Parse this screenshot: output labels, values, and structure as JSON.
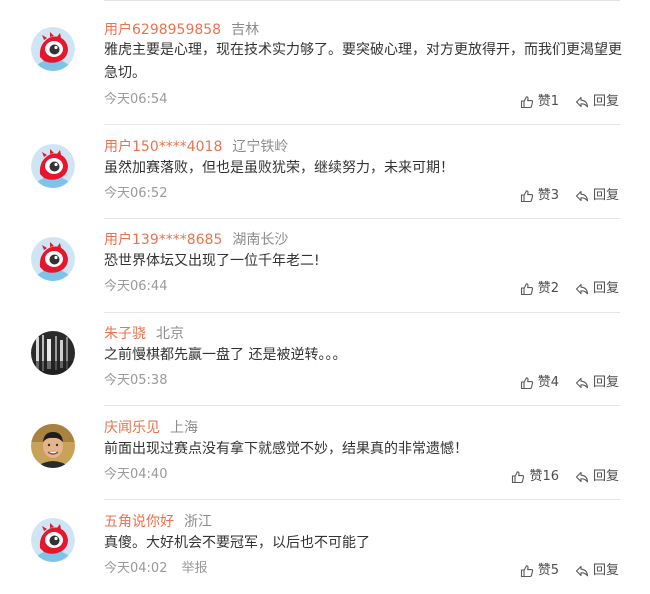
{
  "comments": [
    {
      "user": "用户6298959858",
      "location": "吉林",
      "text": "雅虎主要是心理，现在技术实力够了。要突破心理，对方更放得开，而我们更渴望更急切。",
      "time": "今天06:54",
      "like_label": "赞1",
      "reply_label": "回复",
      "report_label": "",
      "avatar": "weibo-default-avatar"
    },
    {
      "user": "用户150****4018",
      "location": "辽宁铁岭",
      "text": "虽然加赛落败，但也是虽败犹荣，继续努力，未来可期！",
      "time": "今天06:52",
      "like_label": "赞3",
      "reply_label": "回复",
      "report_label": "",
      "avatar": "weibo-default-avatar"
    },
    {
      "user": "用户139****8685",
      "location": "湖南长沙",
      "text": "恐世界体坛又出现了一位千年老二!",
      "time": "今天06:44",
      "like_label": "赞2",
      "reply_label": "回复",
      "report_label": "",
      "avatar": "weibo-default-avatar"
    },
    {
      "user": "朱子骁",
      "location": "北京",
      "text": "之前慢棋都先赢一盘了 还是被逆转。。。",
      "time": "今天05:38",
      "like_label": "赞4",
      "reply_label": "回复",
      "report_label": "",
      "avatar": "photo-avatar-dark"
    },
    {
      "user": "庆闻乐见",
      "location": "上海",
      "text": "前面出现过赛点没有拿下就感觉不妙，结果真的非常遗憾！",
      "time": "今天04:40",
      "like_label": "赞16",
      "reply_label": "回复",
      "report_label": "",
      "avatar": "photo-avatar-person"
    },
    {
      "user": "五角说你好",
      "location": "浙江",
      "text": "真傻。大好机会不要冠军，以后也不可能了",
      "time": "今天04:02",
      "like_label": "赞5",
      "reply_label": "回复",
      "report_label": "举报",
      "avatar": "weibo-default-avatar"
    }
  ],
  "colors": {
    "username": "#eb7350",
    "location": "#8c8c8c",
    "text": "#333333",
    "meta": "#9a9a9a",
    "divider": "#e5e5e5",
    "weibo_red": "#e6162d"
  }
}
